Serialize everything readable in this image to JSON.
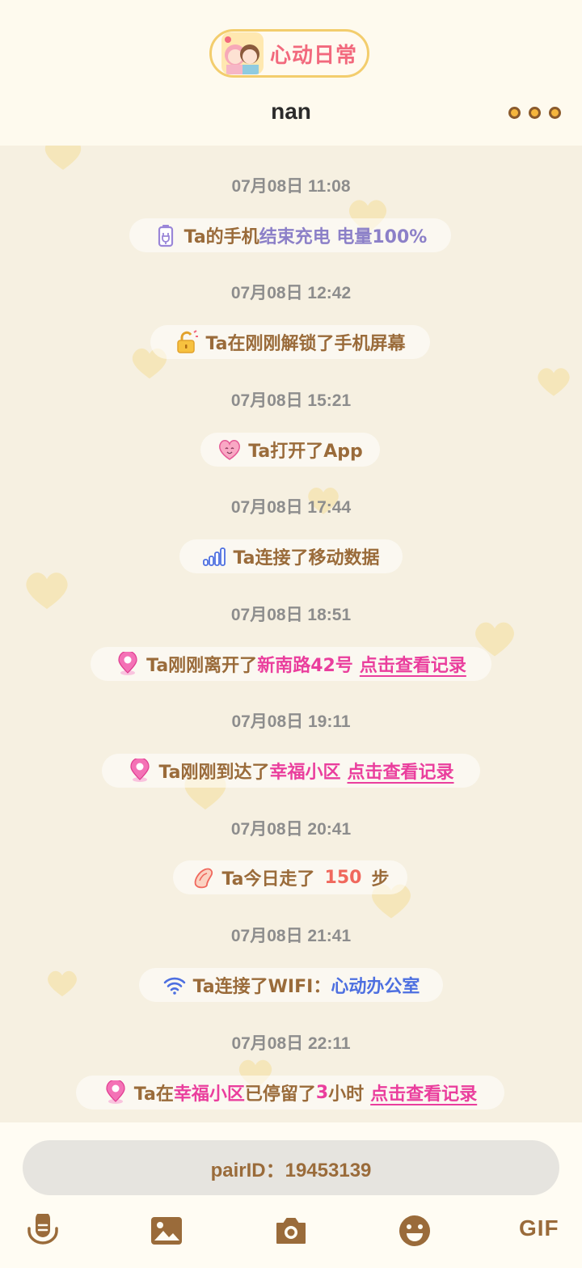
{
  "header": {
    "logo_text": "心动日常",
    "title": "nan"
  },
  "timeline": [
    {
      "time": "07月08日 11:08",
      "icon": "battery-icon",
      "parts": [
        "Ta的手机",
        "结束充电 电量100%"
      ]
    },
    {
      "time": "07月08日 12:42",
      "icon": "unlock-icon",
      "parts": [
        "Ta在刚刚解锁了手机屏幕"
      ]
    },
    {
      "time": "07月08日 15:21",
      "icon": "heart-face-icon",
      "parts": [
        "Ta打开了App"
      ]
    },
    {
      "time": "07月08日 17:44",
      "icon": "signal-icon",
      "parts": [
        "Ta连接了移动数据"
      ]
    },
    {
      "time": "07月08日 18:51",
      "icon": "location-pin-icon",
      "parts": [
        "Ta刚刚离开了",
        "新南路42号",
        "点击查看记录"
      ]
    },
    {
      "time": "07月08日 19:11",
      "icon": "location-pin-icon",
      "parts": [
        "Ta刚刚到达了",
        "幸福小区",
        "点击查看记录"
      ]
    },
    {
      "time": "07月08日 20:41",
      "icon": "footprint-icon",
      "parts": [
        "Ta今日走了",
        "150",
        "步"
      ]
    },
    {
      "time": "07月08日 21:41",
      "icon": "wifi-icon",
      "parts": [
        "Ta连接了WIFI：",
        "心动办公室"
      ]
    },
    {
      "time": "07月08日 22:11",
      "icon": "location-pin-icon",
      "parts": [
        "Ta在",
        "幸福小区",
        "已停留了",
        "3",
        "小时",
        "点击查看记录"
      ]
    }
  ],
  "footer": {
    "pair_id": "pairID：19453139",
    "gif_label": "GIF"
  },
  "colors": {
    "accent_brown": "#9a6b3a",
    "pink": "#ea3e9d",
    "purple": "#8c80c8",
    "blue": "#4d6fe0",
    "red": "#f0685d",
    "logo_border": "#f3cd6d"
  }
}
